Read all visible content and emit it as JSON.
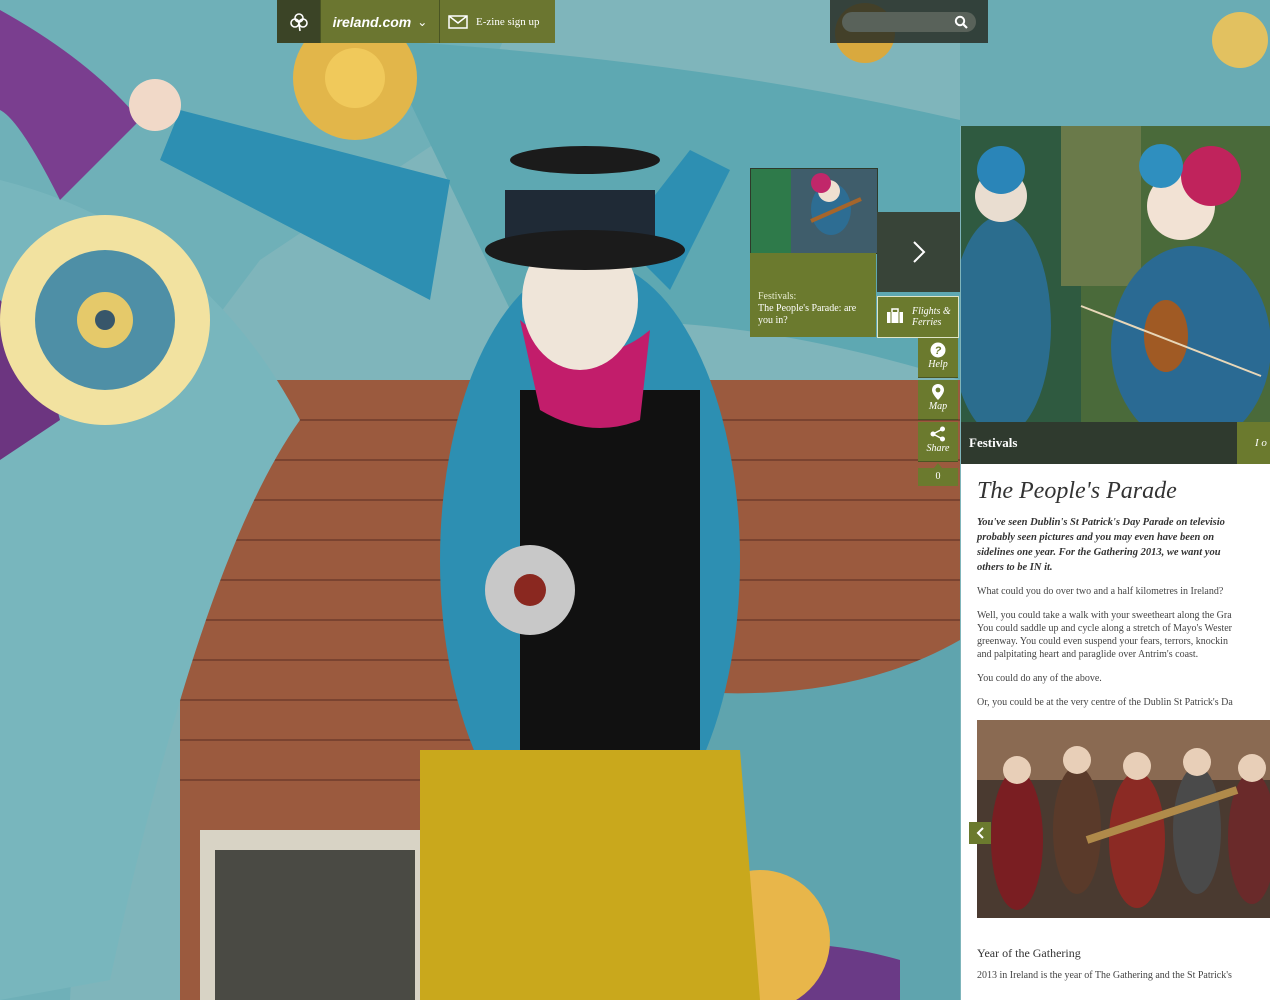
{
  "nav": {
    "brand": "ireland.com",
    "ezine_label": "E-zine sign up",
    "search_placeholder": ""
  },
  "teaser": {
    "category": "Festivals:",
    "title": "The People's Parade: are you in?",
    "flights_label": "Flights & Ferries"
  },
  "tools": {
    "help": "Help",
    "map": "Map",
    "share": "Share",
    "share_count": "0"
  },
  "panel": {
    "bar_title": "Festivals",
    "bar_button": "I o",
    "article": {
      "title": "The People's Parade",
      "intro_lines": [
        "You've seen Dublin's St Patrick's Day Parade on televisio",
        "probably seen pictures and you may even have been on",
        "sidelines one year. For the Gathering 2013, we want you",
        "others to be IN it."
      ],
      "p1": "What could you do over two and a half kilometres in Ireland?",
      "p2_lines": [
        "Well, you could take a walk with your sweetheart along the Gra",
        "You could saddle up and cycle along a stretch of Mayo's Wester",
        "greenway. You could even suspend your fears, terrors, knockin",
        "and palpitating heart and paraglide over Antrim's coast."
      ],
      "p3": "You could do any of the above.",
      "p4": "Or, you could be at the very centre of the Dublin St Patrick's Da",
      "subheading": "Year of the Gathering",
      "tail_lines": [
        "2013 in Ireland is the year of The Gathering and the St Patrick's"
      ]
    }
  },
  "colors": {
    "olive": "#6b7a2e",
    "dark_bar": "#2f3a2e"
  }
}
